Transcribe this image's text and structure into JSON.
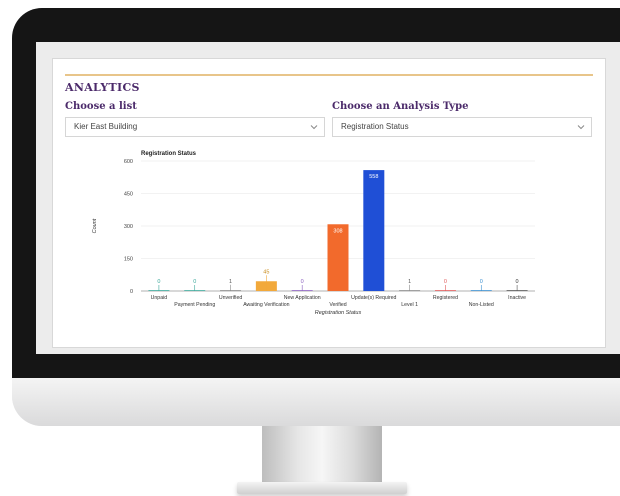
{
  "analytics": {
    "title": "ANALYTICS",
    "list_label": "Choose a list",
    "list_value": "Kier East Building",
    "type_label": "Choose an Analysis Type",
    "type_value": "Registration Status"
  },
  "chart_data": {
    "type": "bar",
    "title": "Registration Status",
    "xlabel": "Registration Status",
    "ylabel": "Count",
    "ylim": [
      0,
      600
    ],
    "yticks": [
      0,
      150,
      300,
      450,
      600
    ],
    "categories": [
      "Unpaid",
      "Payment Pending",
      "Unverified",
      "Awaiting Verification",
      "New Application",
      "Verified",
      "Update(s) Required",
      "Level 1",
      "Registered",
      "Non-Listed",
      "Inactive"
    ],
    "values": [
      0,
      0,
      1,
      45,
      0,
      308,
      558,
      1,
      0,
      0,
      0
    ],
    "bar_colors": [
      "#3aa89a",
      "#3aa89a",
      "#8a8a8a",
      "#f2a93b",
      "#8a5fbf",
      "#f26a2c",
      "#1f4fd6",
      "#8a8a8a",
      "#e05a5a",
      "#3a8fd0",
      "#555555"
    ],
    "label_colors": [
      "#3aa89a",
      "#3aa89a",
      "#555555",
      "#c88a1a",
      "#8a5fbf",
      "#ffffff",
      "#ffffff",
      "#555555",
      "#e05a5a",
      "#3a8fd0",
      "#333333"
    ],
    "grid": true,
    "legend": "none"
  }
}
